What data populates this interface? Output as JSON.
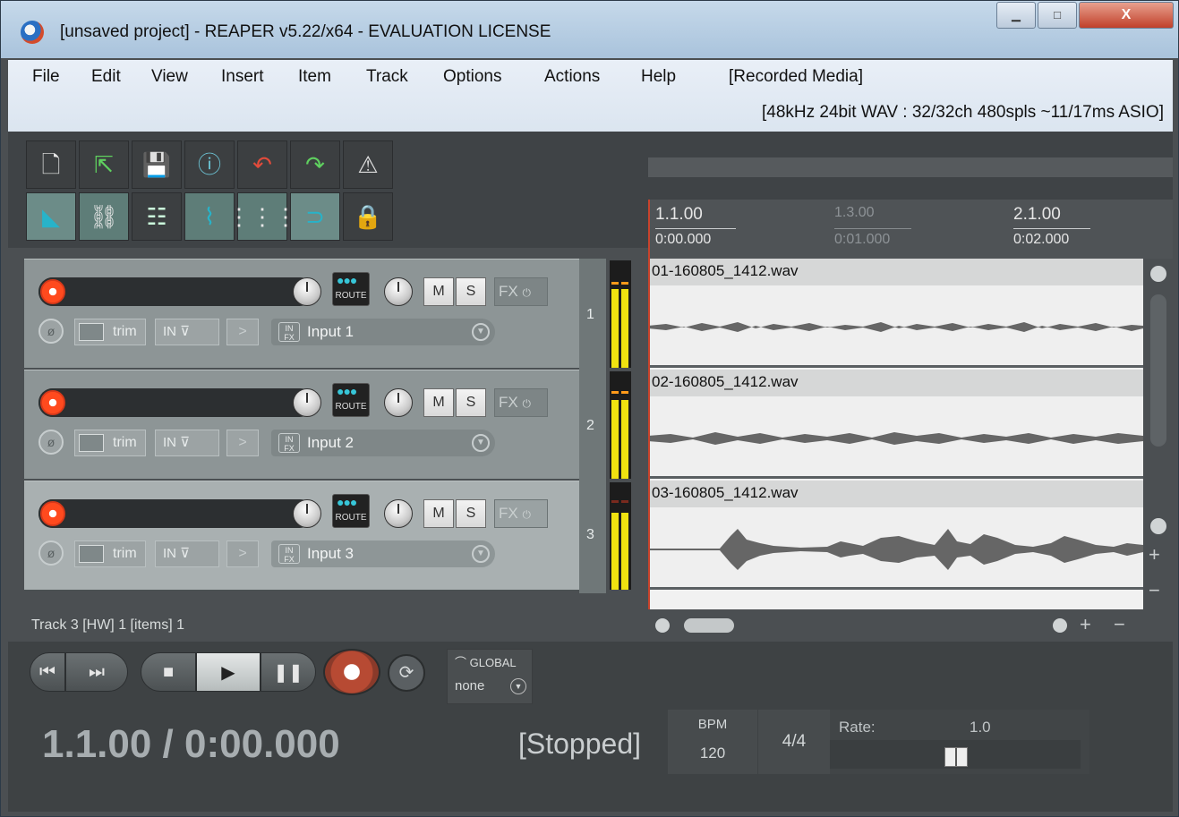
{
  "window": {
    "title": "[unsaved project] - REAPER v5.22/x64 - EVALUATION LICENSE",
    "minimize": "▁",
    "maximize": "□",
    "close": "X"
  },
  "menu": {
    "items": [
      "File",
      "Edit",
      "View",
      "Insert",
      "Item",
      "Track",
      "Options",
      "Actions",
      "Help"
    ],
    "recorded_media": "[Recorded Media]",
    "audio_info": "[48kHz 24bit WAV : 32/32ch 480spls ~11/17ms ASIO]"
  },
  "toolbar": {
    "row1": [
      "new-project-icon",
      "open-project-icon",
      "save-project-icon",
      "project-settings-icon",
      "undo-icon",
      "redo-icon",
      "metronome-icon"
    ],
    "row2": [
      "auto-crossfade-icon",
      "ripple-edit-icon",
      "grouping-icon",
      "envelope-points-icon",
      "snap-grid-icon",
      "loop-icon",
      "lock-icon"
    ]
  },
  "ruler": {
    "marks": [
      {
        "beat": "1.1.00",
        "time": "0:00.000",
        "dim": false
      },
      {
        "beat": "1.3.00",
        "time": "0:01.000",
        "dim": true
      },
      {
        "beat": "2.1.00",
        "time": "0:02.000",
        "dim": false
      }
    ]
  },
  "tracks": [
    {
      "num": "1",
      "name": "",
      "input": "Input 1",
      "mute": "M",
      "solo": "S",
      "fx": "FX",
      "route": "ROUTE",
      "trim": "trim",
      "in": "IN",
      "item": "01-160805_1412.wav",
      "selected": false
    },
    {
      "num": "2",
      "name": "",
      "input": "Input 2",
      "mute": "M",
      "solo": "S",
      "fx": "FX",
      "route": "ROUTE",
      "trim": "trim",
      "in": "IN",
      "item": "02-160805_1412.wav",
      "selected": false
    },
    {
      "num": "3",
      "name": "",
      "input": "Input 3",
      "mute": "M",
      "solo": "S",
      "fx": "FX",
      "route": "ROUTE",
      "trim": "trim",
      "in": "IN",
      "item": "03-160805_1412.wav",
      "selected": true
    }
  ],
  "status": {
    "text": "Track 3 [HW] 1 [items] 1"
  },
  "transport": {
    "automation_label": "GLOBAL",
    "automation_mode": "none",
    "position": "1.1.00 / 0:00.000",
    "state": "[Stopped]",
    "bpm_label": "BPM",
    "bpm": "120",
    "time_signature": "4/4",
    "rate_label": "Rate:",
    "rate": "1.0"
  },
  "colors": {
    "accent_record": "#ff4a1e",
    "meter": "#f0e210",
    "play_cursor": "#c8432c"
  }
}
